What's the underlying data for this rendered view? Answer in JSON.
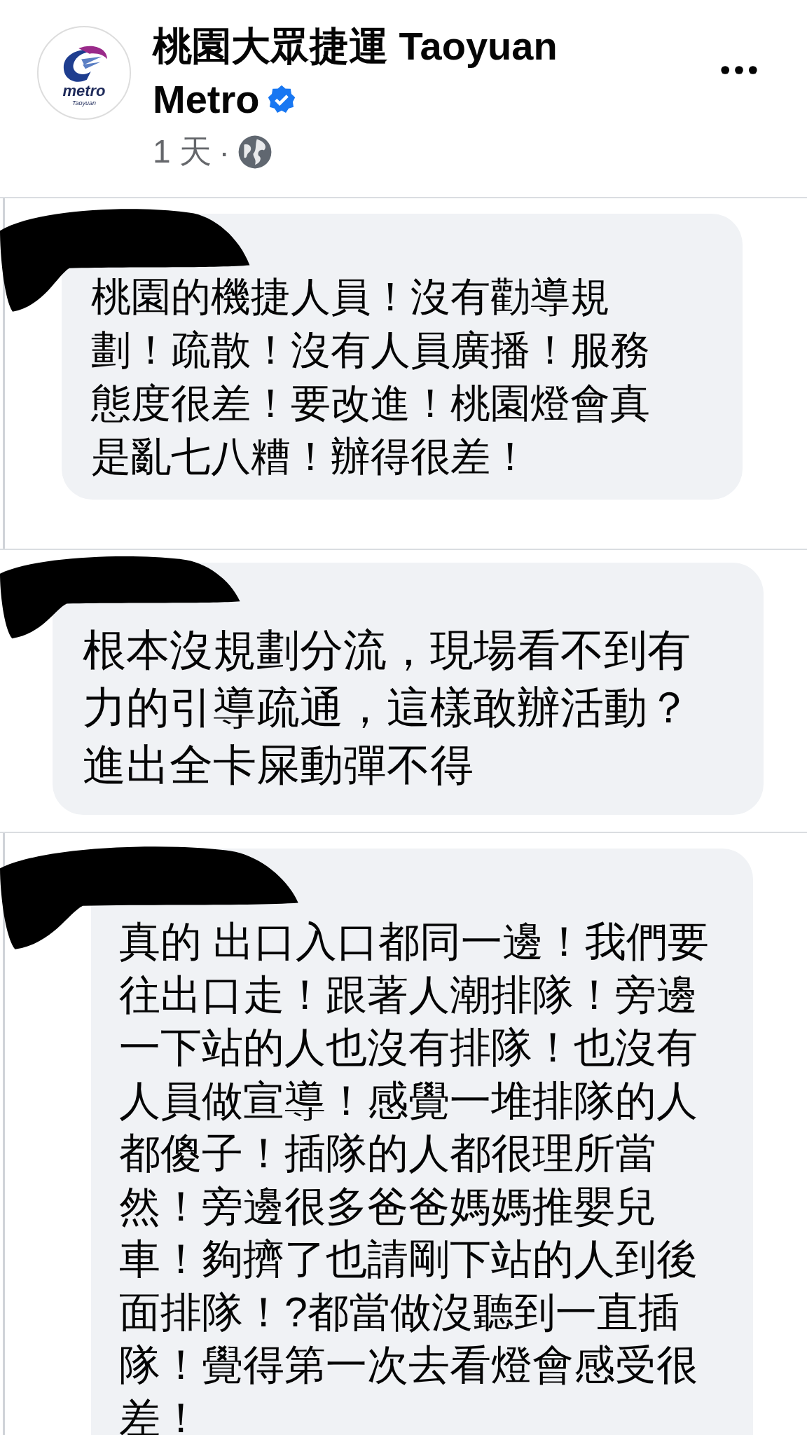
{
  "post": {
    "logo_text": [
      "metro",
      "Taoyuan"
    ],
    "author": "桃園大眾捷運 Taoyuan Metro",
    "verified": true,
    "time": "1 天",
    "separator": "·"
  },
  "comments": [
    {
      "text": "桃園的機捷人員！沒有勸導規劃！疏散！沒有人員廣播！服務態度很差！要改進！桃園燈會真是亂七八糟！辦得很差！",
      "thread_line": true
    },
    {
      "text": "根本沒規劃分流，現場看不到有力的引導疏通，這樣敢辦活動？進出全卡屎動彈不得",
      "thread_line": false
    },
    {
      "text": "真的 出口入口都同一邊！我們要往出口走！跟著人潮排隊！旁邊一下站的人也沒有排隊！也沒有人員做宣導！感覺一堆排隊的人都傻子！插隊的人都很理所當然！旁邊很多爸爸媽媽推嬰兒車！夠擠了也請剛下站的人到後面排隊！?都當做沒聽到一直插隊！覺得第一次去看燈會感受很差！",
      "thread_line": true
    }
  ]
}
